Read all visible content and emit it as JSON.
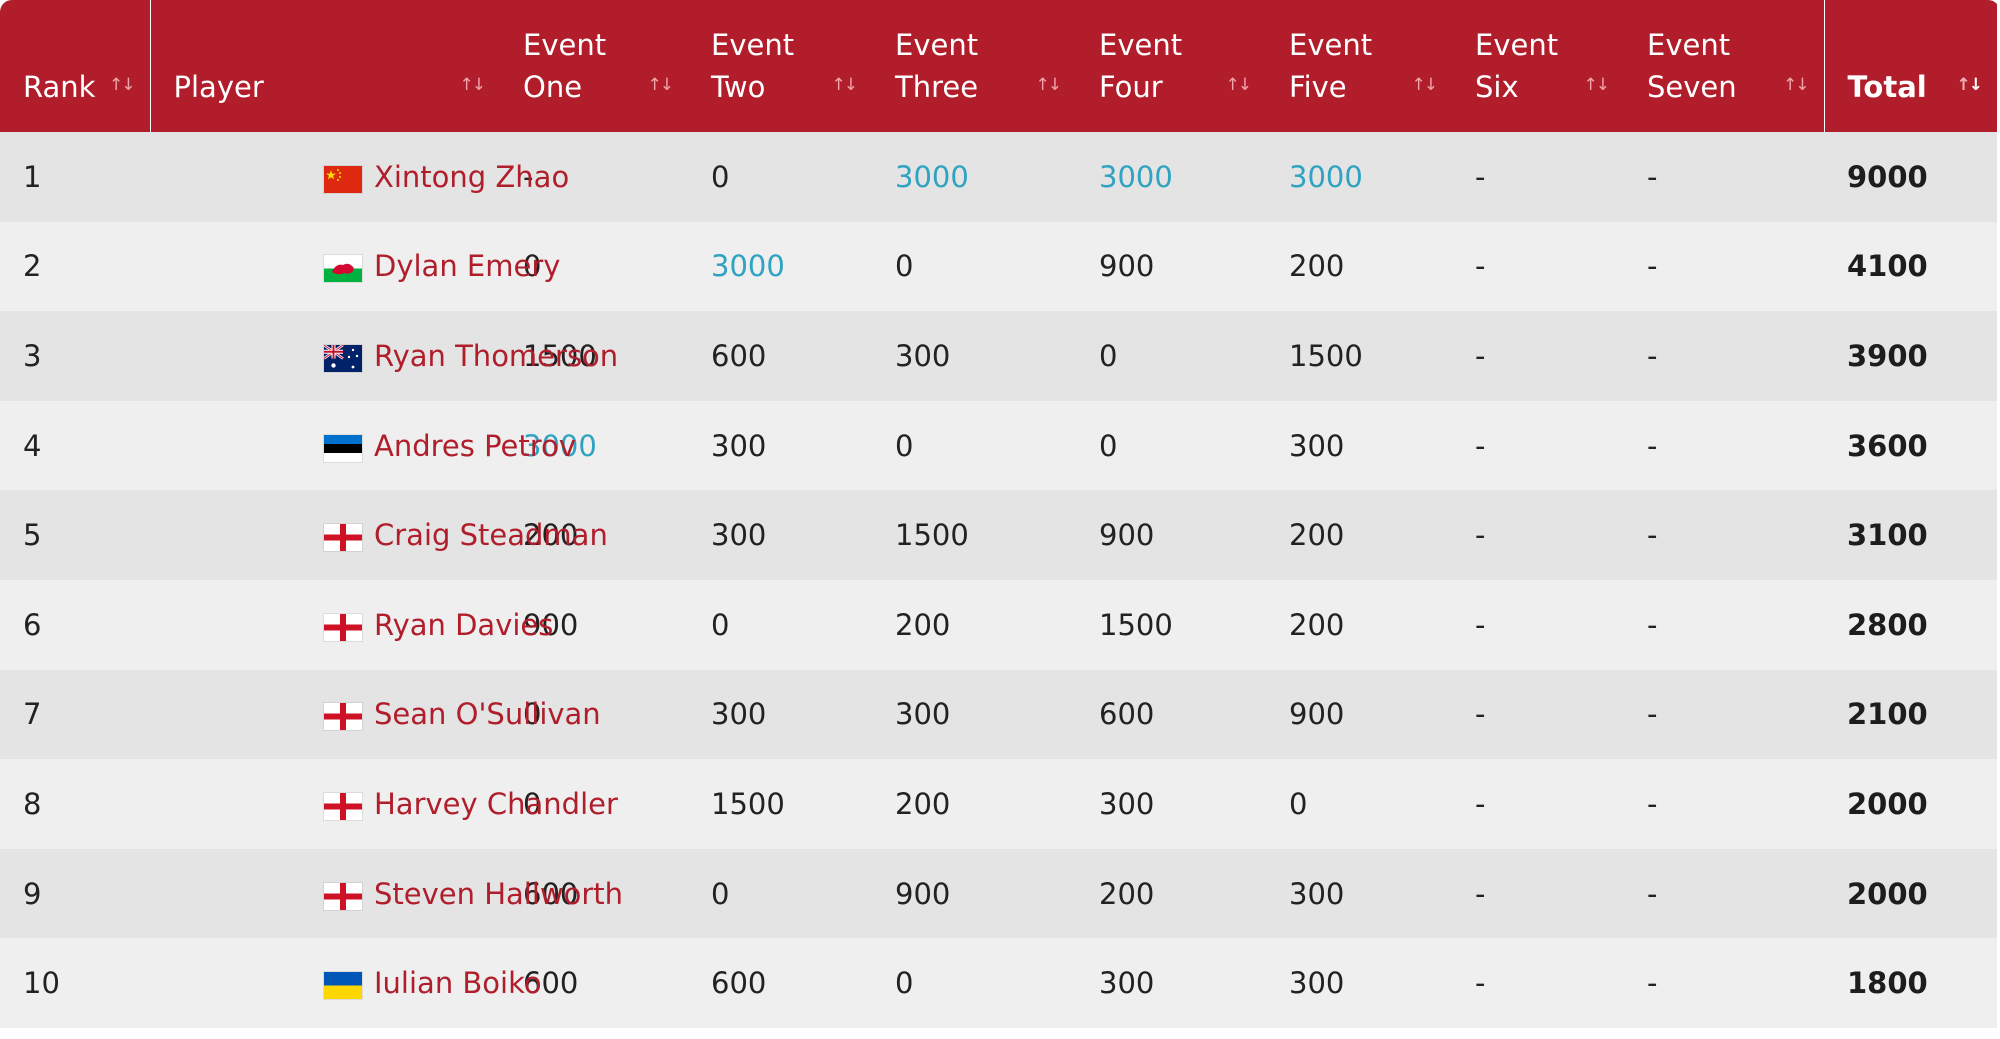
{
  "columns": [
    {
      "label": "Rank"
    },
    {
      "label": "Player"
    },
    {
      "label": "Event One",
      "l1": "Event",
      "l2": "One"
    },
    {
      "label": "Event Two",
      "l1": "Event",
      "l2": "Two"
    },
    {
      "label": "Event Three",
      "l1": "Event",
      "l2": "Three"
    },
    {
      "label": "Event Four",
      "l1": "Event",
      "l2": "Four"
    },
    {
      "label": "Event Five",
      "l1": "Event",
      "l2": "Five"
    },
    {
      "label": "Event Six",
      "l1": "Event",
      "l2": "Six"
    },
    {
      "label": "Event Seven",
      "l1": "Event",
      "l2": "Seven"
    },
    {
      "label": "Total"
    }
  ],
  "sort": {
    "column": "Total",
    "direction": "descending",
    "icon": "sort-arrows-icon"
  },
  "colors": {
    "header_bg": "#b11d2b",
    "player_text": "#b01e2c",
    "highlight": "#2fa3c1"
  },
  "rows": [
    {
      "rank": "1",
      "flag": "china",
      "player": "Xintong Zhao",
      "e1": "-",
      "e2": "0",
      "e3": "3000",
      "e4": "3000",
      "e5": "3000",
      "e6": "-",
      "e7": "-",
      "total": "9000",
      "hl": [
        3,
        4,
        5
      ]
    },
    {
      "rank": "2",
      "flag": "wales",
      "player": "Dylan Emery",
      "e1": "0",
      "e2": "3000",
      "e3": "0",
      "e4": "900",
      "e5": "200",
      "e6": "-",
      "e7": "-",
      "total": "4100",
      "hl": [
        2
      ]
    },
    {
      "rank": "3",
      "flag": "australia",
      "player": "Ryan Thomerson",
      "e1": "1500",
      "e2": "600",
      "e3": "300",
      "e4": "0",
      "e5": "1500",
      "e6": "-",
      "e7": "-",
      "total": "3900",
      "hl": []
    },
    {
      "rank": "4",
      "flag": "estonia",
      "player": "Andres Petrov",
      "e1": "3000",
      "e2": "300",
      "e3": "0",
      "e4": "0",
      "e5": "300",
      "e6": "-",
      "e7": "-",
      "total": "3600",
      "hl": [
        1
      ]
    },
    {
      "rank": "5",
      "flag": "england",
      "player": "Craig Steadman",
      "e1": "200",
      "e2": "300",
      "e3": "1500",
      "e4": "900",
      "e5": "200",
      "e6": "-",
      "e7": "-",
      "total": "3100",
      "hl": []
    },
    {
      "rank": "6",
      "flag": "england",
      "player": "Ryan Davies",
      "e1": "900",
      "e2": "0",
      "e3": "200",
      "e4": "1500",
      "e5": "200",
      "e6": "-",
      "e7": "-",
      "total": "2800",
      "hl": []
    },
    {
      "rank": "7",
      "flag": "england",
      "player": "Sean O'Sullivan",
      "e1": "0",
      "e2": "300",
      "e3": "300",
      "e4": "600",
      "e5": "900",
      "e6": "-",
      "e7": "-",
      "total": "2100",
      "hl": []
    },
    {
      "rank": "8",
      "flag": "england",
      "player": "Harvey Chandler",
      "e1": "0",
      "e2": "1500",
      "e3": "200",
      "e4": "300",
      "e5": "0",
      "e6": "-",
      "e7": "-",
      "total": "2000",
      "hl": []
    },
    {
      "rank": "9",
      "flag": "england",
      "player": "Steven Hallworth",
      "e1": "600",
      "e2": "0",
      "e3": "900",
      "e4": "200",
      "e5": "300",
      "e6": "-",
      "e7": "-",
      "total": "2000",
      "hl": []
    },
    {
      "rank": "10",
      "flag": "ukraine",
      "player": "Iulian Boiko",
      "e1": "600",
      "e2": "600",
      "e3": "0",
      "e4": "300",
      "e5": "300",
      "e6": "-",
      "e7": "-",
      "total": "1800",
      "hl": []
    }
  ]
}
